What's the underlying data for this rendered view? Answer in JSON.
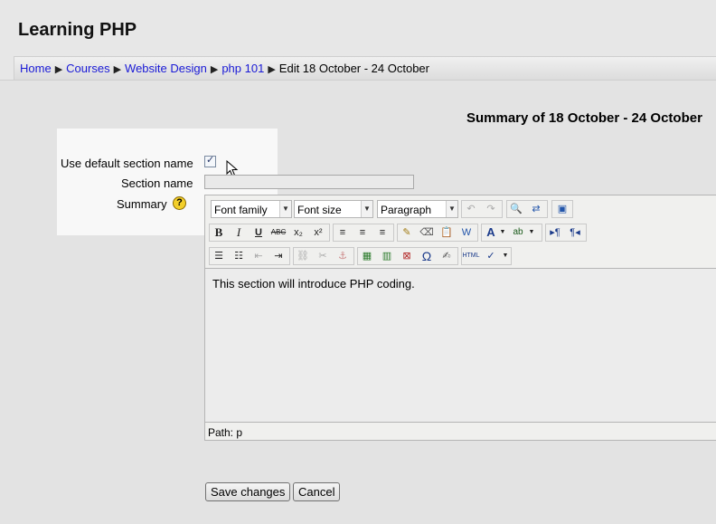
{
  "page": {
    "title": "Learning PHP"
  },
  "breadcrumb": {
    "separator": "▶",
    "items": [
      "Home",
      "Courses",
      "Website Design",
      "php 101"
    ],
    "current": "Edit 18 October - 24 October"
  },
  "form": {
    "heading": "Summary of 18 October - 24 October",
    "use_default_label": "Use default section name",
    "use_default_checked": true,
    "section_name_label": "Section name",
    "section_name_value": "",
    "summary_label": "Summary",
    "help_icon_glyph": "?"
  },
  "editor": {
    "font_family": "Font family",
    "font_size": "Font size",
    "format": "Paragraph",
    "content": "This section will introduce PHP coding.",
    "path": "Path: p",
    "toolbar_icons": [
      "undo-icon",
      "redo-icon",
      "find-icon",
      "replace-icon",
      "fullscreen-icon",
      "bold-icon",
      "italic-icon",
      "underline-icon",
      "strikethrough-icon",
      "subscript-icon",
      "superscript-icon",
      "align-left-icon",
      "align-center-icon",
      "align-right-icon",
      "cleanup-icon",
      "eraser-icon",
      "paste-text-icon",
      "paste-word-icon",
      "text-color-icon",
      "highlight-color-icon",
      "ltr-icon",
      "rtl-icon",
      "bullet-list-icon",
      "numbered-list-icon",
      "outdent-icon",
      "indent-icon",
      "link-icon",
      "unlink-icon",
      "anchor-icon",
      "image-icon",
      "media-icon",
      "nolink-icon",
      "special-char-icon",
      "edit-icon",
      "html-icon",
      "spellcheck-icon"
    ]
  },
  "buttons": {
    "save": "Save changes",
    "cancel": "Cancel"
  }
}
